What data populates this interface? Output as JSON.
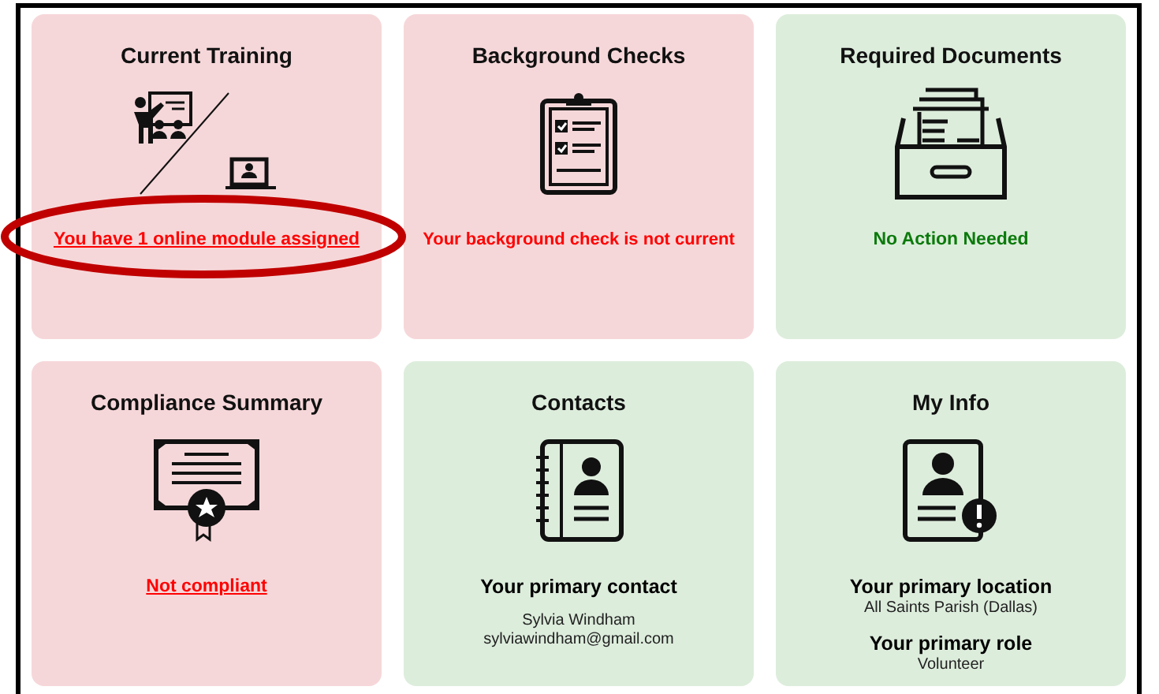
{
  "cards": [
    {
      "title": "Current Training",
      "color": "#f6d7d9",
      "kind": "training",
      "circled": true,
      "lines": [
        {
          "kind": "link",
          "text": "You have 1 online module assigned"
        }
      ]
    },
    {
      "title": "Background Checks",
      "color": "#f6d7d9",
      "kind": "clipboard",
      "circled": false,
      "lines": [
        {
          "kind": "alert",
          "text": "Your background check is not current"
        }
      ]
    },
    {
      "title": "Required Documents",
      "color": "#ddeddc",
      "kind": "drawer",
      "circled": false,
      "lines": [
        {
          "kind": "ok",
          "text": "No Action Needed"
        }
      ]
    },
    {
      "title": "Compliance Summary",
      "color": "#f6d7d9",
      "kind": "certificate",
      "circled": false,
      "lines": [
        {
          "kind": "link",
          "text": "Not compliant"
        }
      ]
    },
    {
      "title": "Contacts",
      "color": "#ddeddc",
      "kind": "contacts",
      "circled": false,
      "lines": [
        {
          "kind": "heading",
          "text": "Your primary contact"
        },
        {
          "kind": "gap"
        },
        {
          "kind": "text",
          "text": "Sylvia Windham"
        },
        {
          "kind": "text",
          "text": "sylviawindham@gmail.com"
        }
      ]
    },
    {
      "title": "My Info",
      "color": "#ddeddc",
      "kind": "info",
      "circled": false,
      "lines": [
        {
          "kind": "heading",
          "text": "Your primary location"
        },
        {
          "kind": "text",
          "text": "All Saints Parish (Dallas)"
        },
        {
          "kind": "gap"
        },
        {
          "kind": "heading",
          "text": "Your primary role"
        },
        {
          "kind": "text",
          "text": "Volunteer"
        }
      ]
    }
  ]
}
